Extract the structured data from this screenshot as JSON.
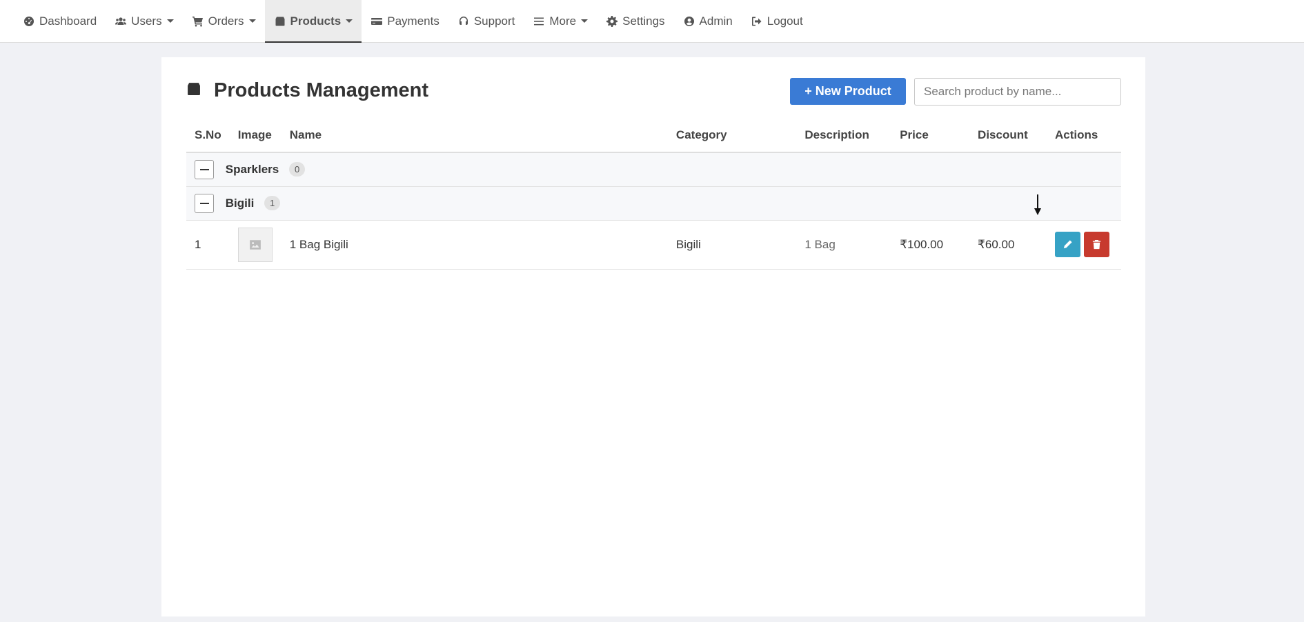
{
  "nav": {
    "items": [
      {
        "label": "Dashboard",
        "icon": "dashboard-icon"
      },
      {
        "label": "Users",
        "icon": "users-icon",
        "dropdown": true
      },
      {
        "label": "Orders",
        "icon": "cart-icon",
        "dropdown": true
      },
      {
        "label": "Products",
        "icon": "box-icon",
        "dropdown": true,
        "active": true
      },
      {
        "label": "Payments",
        "icon": "credit-card-icon"
      },
      {
        "label": "Support",
        "icon": "headset-icon"
      },
      {
        "label": "More",
        "icon": "bars-icon",
        "dropdown": true
      },
      {
        "label": "Settings",
        "icon": "gear-icon"
      },
      {
        "label": "Admin",
        "icon": "user-circle-icon"
      },
      {
        "label": "Logout",
        "icon": "logout-icon"
      }
    ]
  },
  "page": {
    "title": "Products Management",
    "new_button": "+ New Product",
    "search_placeholder": "Search product by name..."
  },
  "table": {
    "headers": [
      "S.No",
      "Image",
      "Name",
      "Category",
      "Description",
      "Price",
      "Discount",
      "Actions"
    ],
    "groups": [
      {
        "name": "Sparklers",
        "count": "0"
      },
      {
        "name": "Bigili",
        "count": "1"
      }
    ],
    "rows": [
      {
        "sno": "1",
        "name": "1 Bag Bigili",
        "category": "Bigili",
        "description": "1 Bag",
        "price": "₹100.00",
        "discount": "₹60.00"
      }
    ]
  },
  "colors": {
    "primary": "#3a7bd5",
    "edit": "#36a2c5",
    "delete": "#c73a2e"
  }
}
